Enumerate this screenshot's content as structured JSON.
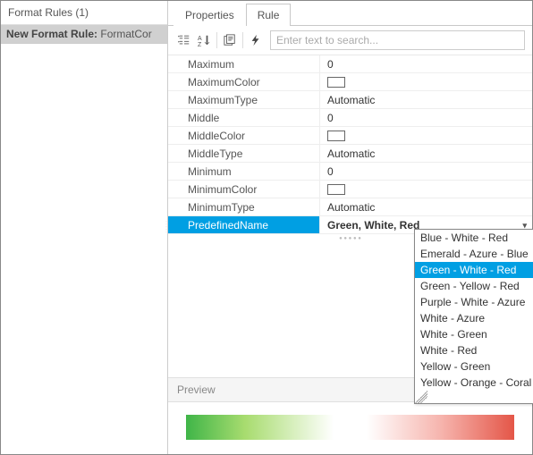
{
  "left": {
    "header": "Format Rules (1)",
    "item_label": "New Format Rule:",
    "item_name": "FormatCor"
  },
  "tabs": {
    "properties": "Properties",
    "rule": "Rule"
  },
  "search": {
    "placeholder": "Enter text to search..."
  },
  "props": {
    "maximum": {
      "label": "Maximum",
      "value": "0"
    },
    "maximum_color": {
      "label": "MaximumColor"
    },
    "maximum_type": {
      "label": "MaximumType",
      "value": "Automatic"
    },
    "middle": {
      "label": "Middle",
      "value": "0"
    },
    "middle_color": {
      "label": "MiddleColor"
    },
    "middle_type": {
      "label": "MiddleType",
      "value": "Automatic"
    },
    "minimum": {
      "label": "Minimum",
      "value": "0"
    },
    "minimum_color": {
      "label": "MinimumColor"
    },
    "minimum_type": {
      "label": "MinimumType",
      "value": "Automatic"
    },
    "predefined": {
      "label": "PredefinedName",
      "value": "Green, White, Red"
    }
  },
  "dropdown": {
    "opt0": "Blue - White - Red",
    "opt1": "Emerald - Azure - Blue",
    "opt2": "Green - White - Red",
    "opt3": "Green - Yellow - Red",
    "opt4": "Purple - White - Azure",
    "opt5": "White - Azure",
    "opt6": "White - Green",
    "opt7": "White - Red",
    "opt8": "Yellow - Green",
    "opt9": "Yellow - Orange - Coral"
  },
  "preview": {
    "label": "Preview"
  },
  "chart_data": {
    "type": "area",
    "title": "Preview",
    "description": "3-color scale format preview gradient",
    "stops": [
      {
        "position": 0.0,
        "color": "#3fb548"
      },
      {
        "position": 0.5,
        "color": "#ffffff"
      },
      {
        "position": 1.0,
        "color": "#e45648"
      }
    ]
  }
}
